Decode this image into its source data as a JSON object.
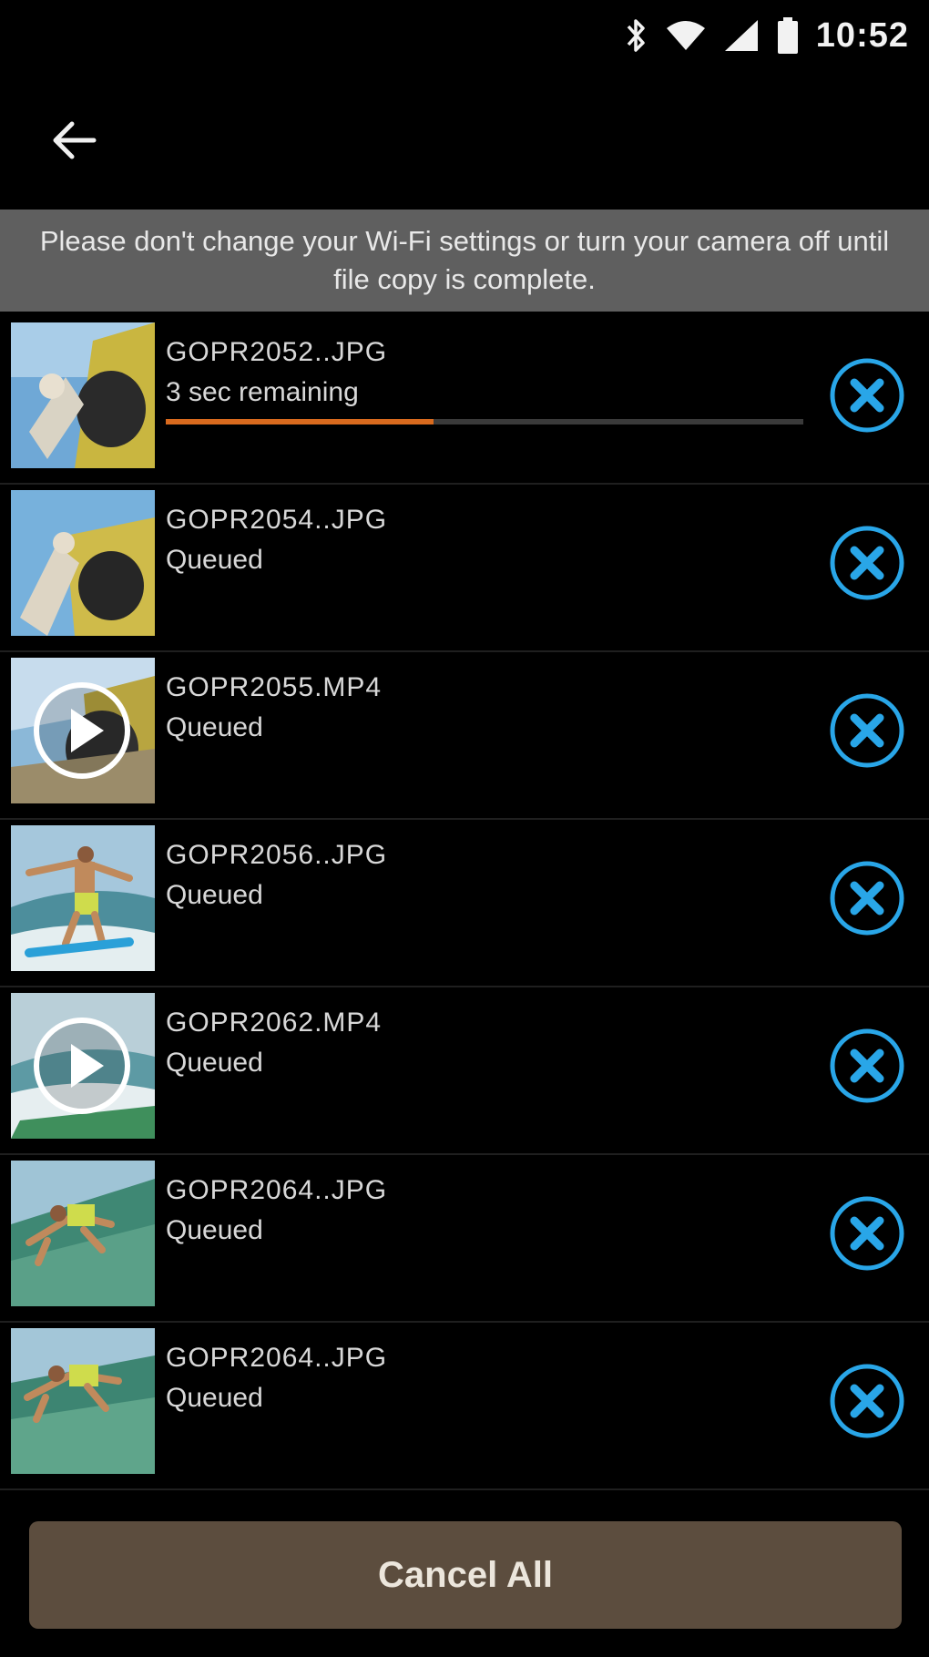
{
  "status_bar": {
    "time": "10:52",
    "icons": [
      "bluetooth-icon",
      "wifi-icon",
      "signal-icon",
      "battery-icon"
    ]
  },
  "app_bar": {
    "back_icon": "arrow-left-icon"
  },
  "notice": {
    "text": "Please don't change your Wi-Fi settings or turn your camera off until file copy is complete."
  },
  "files": [
    {
      "name": "GOPR2052..JPG",
      "status": "3 sec remaining",
      "progress": 0.42,
      "type": "photo"
    },
    {
      "name": "GOPR2054..JPG",
      "status": "Queued",
      "type": "photo"
    },
    {
      "name": "GOPR2055.MP4",
      "status": "Queued",
      "type": "video"
    },
    {
      "name": "GOPR2056..JPG",
      "status": "Queued",
      "type": "photo"
    },
    {
      "name": "GOPR2062.MP4",
      "status": "Queued",
      "type": "video"
    },
    {
      "name": "GOPR2064..JPG",
      "status": "Queued",
      "type": "photo"
    },
    {
      "name": "GOPR2064..JPG",
      "status": "Queued",
      "type": "photo"
    }
  ],
  "cancel_all_label": "Cancel All",
  "colors": {
    "accent_blue": "#29a6e8",
    "progress_orange": "#d86a1e",
    "banner_gray": "#5f5f5f",
    "button_brown": "#5c4d3e"
  }
}
